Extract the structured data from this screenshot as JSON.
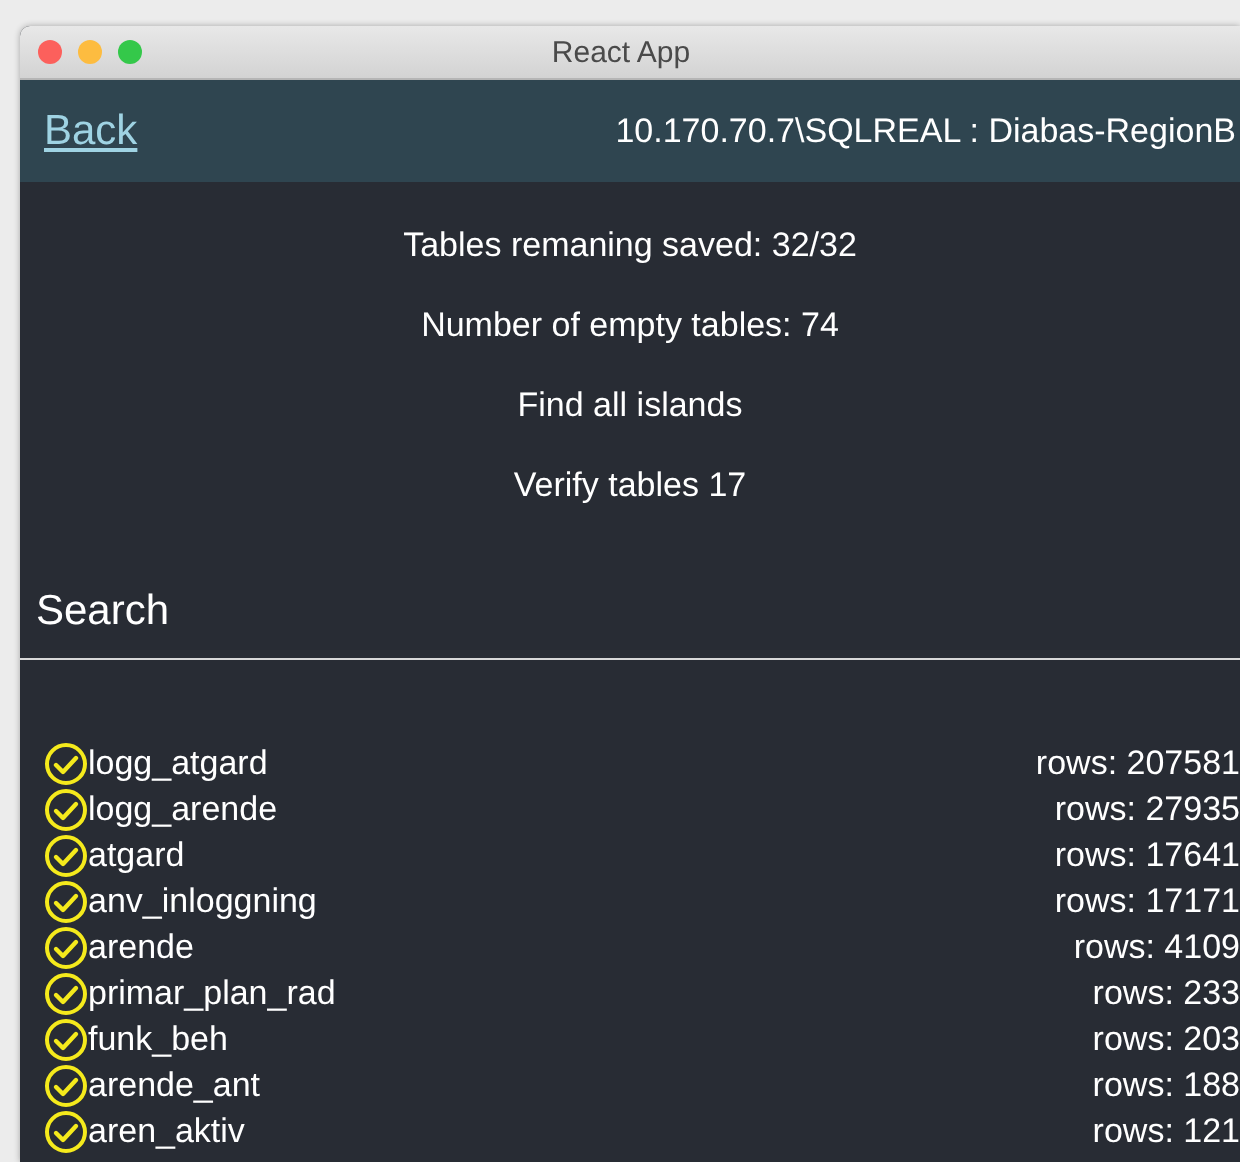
{
  "window": {
    "title": "React App"
  },
  "header": {
    "back_link": "Back",
    "connection": "10.170.70.7\\SQLREAL : Diabas-RegionB"
  },
  "summary": [
    "Tables remaning saved: 32/32",
    "Number of empty tables: 74",
    "Find all islands",
    "Verify tables 17"
  ],
  "search": {
    "placeholder": "Search"
  },
  "tables": [
    {
      "name": "logg_atgard",
      "rows": "rows: 207581",
      "checked": true
    },
    {
      "name": "logg_arende",
      "rows": "rows: 27935",
      "checked": true
    },
    {
      "name": "atgard",
      "rows": "rows: 17641",
      "checked": true
    },
    {
      "name": "anv_inloggning",
      "rows": "rows: 17171",
      "checked": true
    },
    {
      "name": "arende",
      "rows": "rows: 4109",
      "checked": true
    },
    {
      "name": "primar_plan_rad",
      "rows": "rows: 233",
      "checked": true
    },
    {
      "name": "funk_beh",
      "rows": "rows: 203",
      "checked": true
    },
    {
      "name": "arende_ant",
      "rows": "rows: 188",
      "checked": true
    },
    {
      "name": "aren_aktiv",
      "rows": "rows: 121",
      "checked": true
    }
  ]
}
